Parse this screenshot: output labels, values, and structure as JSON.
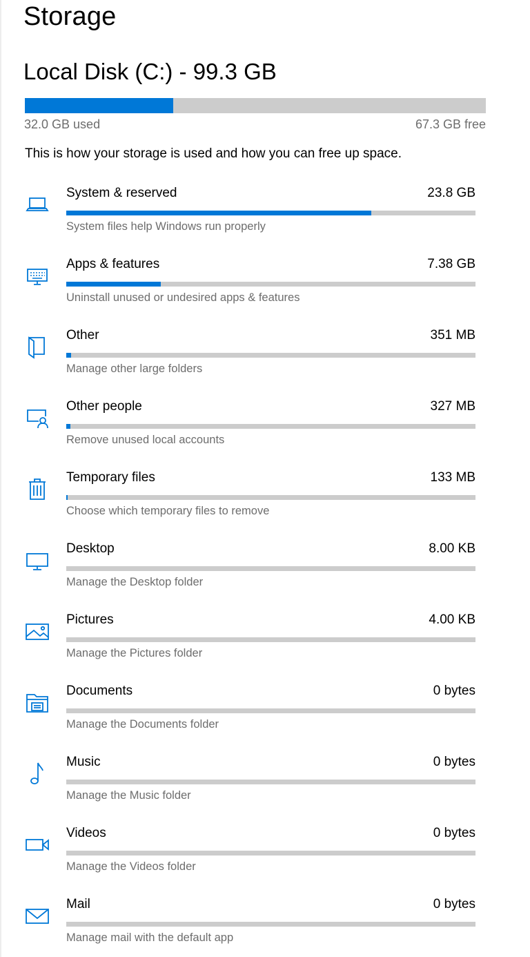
{
  "page": {
    "title": "Storage"
  },
  "disk": {
    "title": "Local Disk (C:) - 99.3 GB",
    "used_label": "32.0 GB used",
    "free_label": "67.3 GB free",
    "used_fraction": 0.322,
    "color_used": "#0078d7",
    "color_track": "#cccccc"
  },
  "intro": "This is how your storage is used and how you can free up space.",
  "categories": [
    {
      "icon": "laptop-icon",
      "name": "System & reserved",
      "size": "23.8 GB",
      "description": "System files help Windows run properly",
      "fraction": 0.745
    },
    {
      "icon": "keyboard-monitor-icon",
      "name": "Apps & features",
      "size": "7.38 GB",
      "description": "Uninstall unused or undesired apps & features",
      "fraction": 0.231
    },
    {
      "icon": "folder-book-icon",
      "name": "Other",
      "size": "351 MB",
      "description": "Manage other large folders",
      "fraction": 0.011
    },
    {
      "icon": "people-icon",
      "name": "Other people",
      "size": "327 MB",
      "description": "Remove unused local accounts",
      "fraction": 0.01
    },
    {
      "icon": "trash-icon",
      "name": "Temporary files",
      "size": "133 MB",
      "description": "Choose which temporary files to remove",
      "fraction": 0.004
    },
    {
      "icon": "desktop-icon",
      "name": "Desktop",
      "size": "8.00 KB",
      "description": "Manage the Desktop folder",
      "fraction": 0
    },
    {
      "icon": "pictures-icon",
      "name": "Pictures",
      "size": "4.00 KB",
      "description": "Manage the Pictures folder",
      "fraction": 0
    },
    {
      "icon": "documents-icon",
      "name": "Documents",
      "size": "0 bytes",
      "description": "Manage the Documents folder",
      "fraction": 0
    },
    {
      "icon": "music-icon",
      "name": "Music",
      "size": "0 bytes",
      "description": "Manage the Music folder",
      "fraction": 0
    },
    {
      "icon": "video-camera-icon",
      "name": "Videos",
      "size": "0 bytes",
      "description": "Manage the Videos folder",
      "fraction": 0
    },
    {
      "icon": "mail-icon",
      "name": "Mail",
      "size": "0 bytes",
      "description": "Manage mail with the default app",
      "fraction": 0
    }
  ]
}
